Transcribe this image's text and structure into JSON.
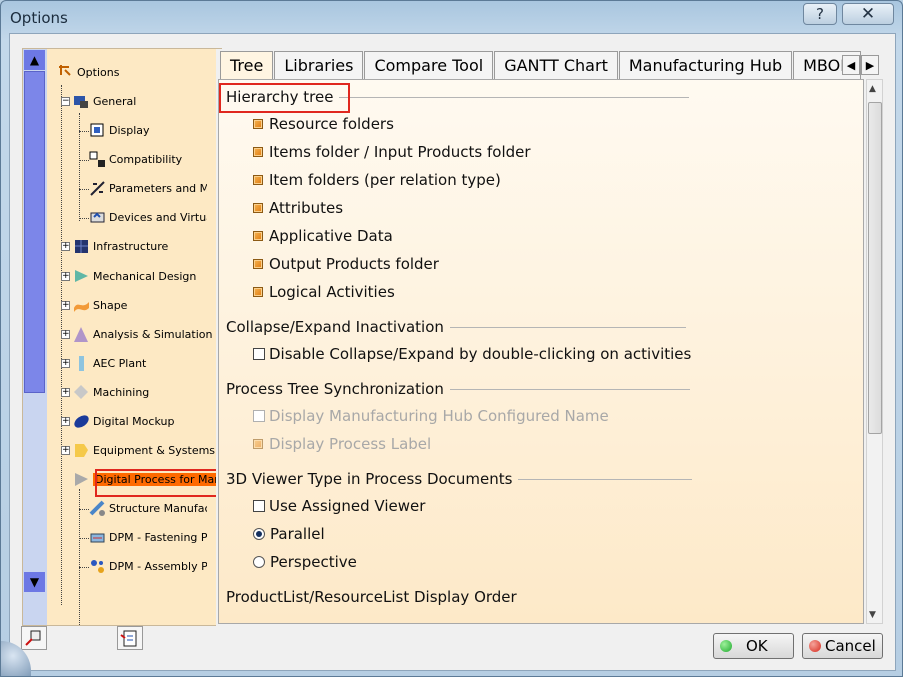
{
  "window": {
    "title": "Options",
    "help": "?",
    "close": "✕"
  },
  "tree": {
    "items": [
      {
        "label": "Options",
        "icon": "options-icon"
      },
      {
        "label": "General",
        "icon": "general-icon"
      },
      {
        "label": "Display",
        "icon": "display-icon"
      },
      {
        "label": "Compatibility",
        "icon": "compatibility-icon"
      },
      {
        "label": "Parameters and Measure",
        "icon": "parameters-icon"
      },
      {
        "label": "Devices and Virtual Reality",
        "icon": "devices-icon"
      },
      {
        "label": "Infrastructure",
        "icon": "infrastructure-icon"
      },
      {
        "label": "Mechanical Design",
        "icon": "mechanical-design-icon"
      },
      {
        "label": "Shape",
        "icon": "shape-icon"
      },
      {
        "label": "Analysis & Simulation",
        "icon": "analysis-icon"
      },
      {
        "label": "AEC Plant",
        "icon": "aec-plant-icon"
      },
      {
        "label": "Machining",
        "icon": "machining-icon"
      },
      {
        "label": "Digital Mockup",
        "icon": "digital-mockup-icon"
      },
      {
        "label": "Equipment & Systems",
        "icon": "equipment-icon"
      },
      {
        "label": "Digital Process for Manufacturing",
        "icon": "digital-process-icon"
      },
      {
        "label": "Structure Manufacturing",
        "icon": "structure-manufacturing-icon"
      },
      {
        "label": "DPM - Fastening Process",
        "icon": "fastening-icon"
      },
      {
        "label": "DPM - Assembly Process",
        "icon": "assembly-icon"
      }
    ]
  },
  "tabs": [
    "Tree",
    "Libraries",
    "Compare Tool",
    "GANTT Chart",
    "Manufacturing Hub",
    "MBOM"
  ],
  "content": {
    "hierarchy": {
      "title": "Hierarchy tree",
      "items": [
        "Resource folders",
        "Items folder / Input Products folder",
        "Item folders (per relation type)",
        "Attributes",
        "Applicative Data",
        "Output Products folder",
        "Logical Activities"
      ]
    },
    "collapse": {
      "title": "Collapse/Expand Inactivation",
      "option": "Disable Collapse/Expand by double-clicking on activities"
    },
    "sync": {
      "title": "Process Tree Synchronization",
      "opt1": "Display Manufacturing Hub Configured Name",
      "opt2": "Display Process Label"
    },
    "viewer": {
      "title": "3D Viewer Type in Process Documents",
      "opt1": "Use Assigned Viewer",
      "opt2": "Parallel",
      "opt3": "Perspective"
    },
    "order": {
      "title": "ProductList/ResourceList Display Order"
    }
  },
  "buttons": {
    "ok": "OK",
    "cancel": "Cancel"
  },
  "colors": {
    "accent": "#ff6a00",
    "highlight_box": "#e0271e",
    "ok_dot": "#1faa2e",
    "cancel_dot": "#d62a1e"
  }
}
